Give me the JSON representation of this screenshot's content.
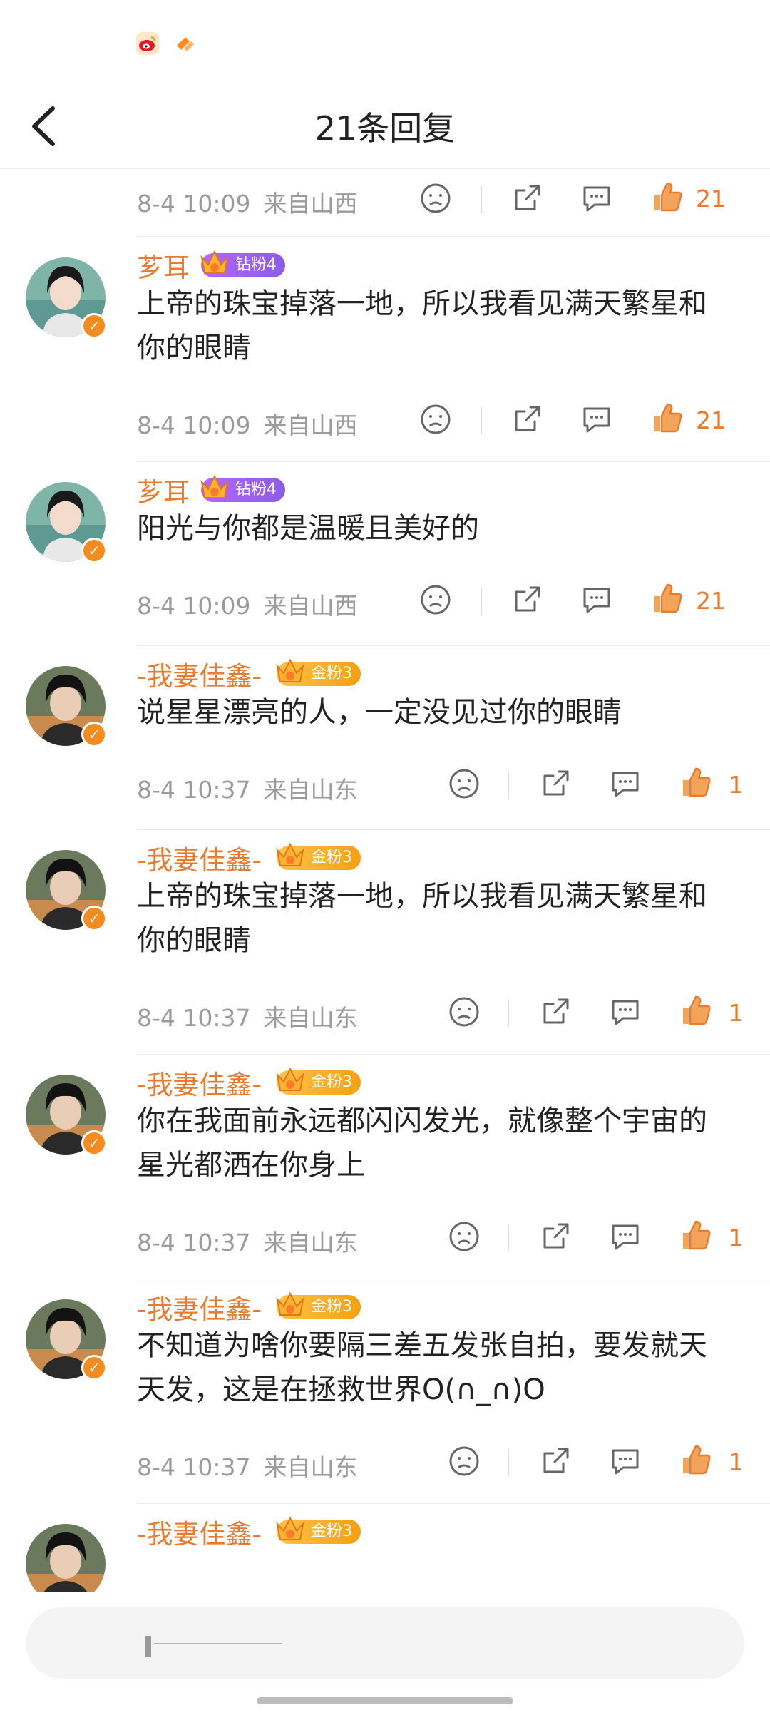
{
  "header": {
    "title": "21条回复"
  },
  "colors": {
    "accent": "#eb7a2c",
    "verified": "#f58b1e"
  },
  "comments": [
    {
      "date": "8-4 10:09",
      "location": "来自山西",
      "likes": "21"
    },
    {
      "user": "芗耳",
      "badge": "钻粉4",
      "badge_type": "diamond",
      "text": "上帝的珠宝掉落一地，所以我看见满天繁星和你的眼睛",
      "date": "8-4 10:09",
      "location": "来自山西",
      "likes": "21"
    },
    {
      "user": "芗耳",
      "badge": "钻粉4",
      "badge_type": "diamond",
      "text": "阳光与你都是温暖且美好的",
      "date": "8-4 10:09",
      "location": "来自山西",
      "likes": "21"
    },
    {
      "user": "-我妻佳鑫-",
      "badge": "金粉3",
      "badge_type": "gold",
      "text": "说星星漂亮的人，一定没见过你的眼睛",
      "date": "8-4 10:37",
      "location": "来自山东",
      "likes": "1"
    },
    {
      "user": "-我妻佳鑫-",
      "badge": "金粉3",
      "badge_type": "gold",
      "text": "上帝的珠宝掉落一地，所以我看见满天繁星和你的眼睛",
      "date": "8-4 10:37",
      "location": "来自山东",
      "likes": "1"
    },
    {
      "user": "-我妻佳鑫-",
      "badge": "金粉3",
      "badge_type": "gold",
      "text": "你在我面前永远都闪闪发光，就像整个宇宙的星光都洒在你身上",
      "date": "8-4 10:37",
      "location": "来自山东",
      "likes": "1"
    },
    {
      "user": "-我妻佳鑫-",
      "badge": "金粉3",
      "badge_type": "gold",
      "text": "不知道为啥你要隔三差五发张自拍，要发就天天发，这是在拯救世界O(∩_∩)O",
      "date": "8-4 10:37",
      "location": "来自山东",
      "likes": "1"
    },
    {
      "user": "-我妻佳鑫-",
      "badge": "金粉3",
      "badge_type": "gold"
    }
  ]
}
